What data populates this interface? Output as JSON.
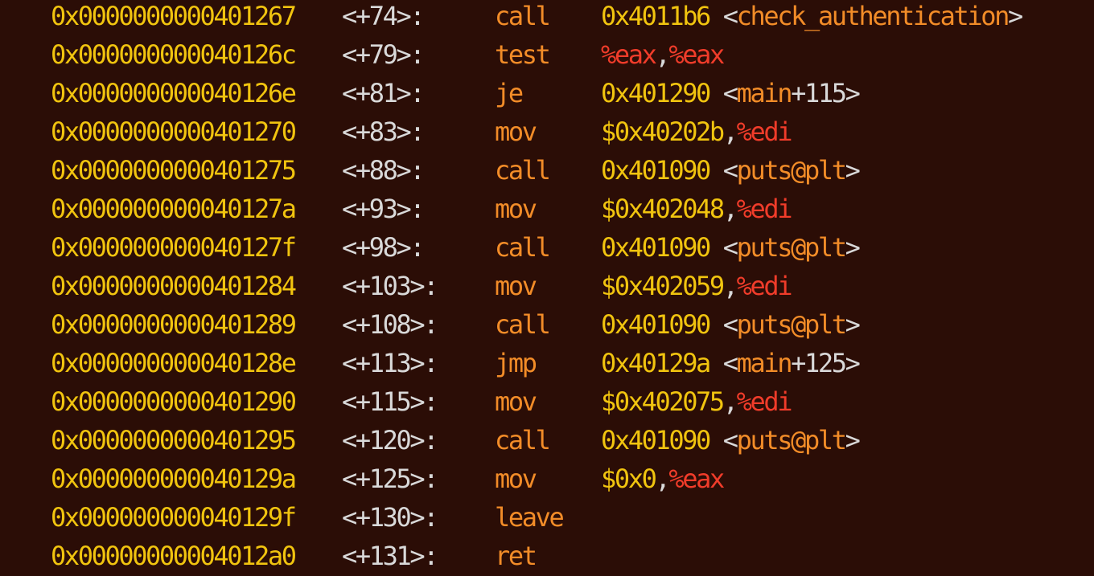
{
  "colors": {
    "background": "#2b0d06",
    "address": "#f1c40f",
    "offset": "#d9d9d9",
    "mnemonic": "#f28c28",
    "number": "#f1c40f",
    "register": "#f03c2a",
    "symbol": "#f28c28"
  },
  "disassembly": [
    {
      "address": "0x0000000000401267",
      "offset": "<+74>:",
      "mnemonic": "call",
      "operands": [
        {
          "t": "num",
          "v": "0x4011b6"
        },
        {
          "t": "plain",
          "v": " <"
        },
        {
          "t": "sym",
          "v": "check_authentication"
        },
        {
          "t": "plain",
          "v": ">"
        }
      ]
    },
    {
      "address": "0x000000000040126c",
      "offset": "<+79>:",
      "mnemonic": "test",
      "operands": [
        {
          "t": "reg",
          "v": "%eax"
        },
        {
          "t": "plain",
          "v": ","
        },
        {
          "t": "reg",
          "v": "%eax"
        }
      ]
    },
    {
      "address": "0x000000000040126e",
      "offset": "<+81>:",
      "mnemonic": "je",
      "operands": [
        {
          "t": "num",
          "v": "0x401290"
        },
        {
          "t": "plain",
          "v": " <"
        },
        {
          "t": "sym",
          "v": "main"
        },
        {
          "t": "plain",
          "v": "+115>"
        }
      ]
    },
    {
      "address": "0x0000000000401270",
      "offset": "<+83>:",
      "mnemonic": "mov",
      "operands": [
        {
          "t": "num",
          "v": "$0x40202b"
        },
        {
          "t": "plain",
          "v": ","
        },
        {
          "t": "reg",
          "v": "%edi"
        }
      ]
    },
    {
      "address": "0x0000000000401275",
      "offset": "<+88>:",
      "mnemonic": "call",
      "operands": [
        {
          "t": "num",
          "v": "0x401090"
        },
        {
          "t": "plain",
          "v": " <"
        },
        {
          "t": "sym",
          "v": "puts@plt"
        },
        {
          "t": "plain",
          "v": ">"
        }
      ]
    },
    {
      "address": "0x000000000040127a",
      "offset": "<+93>:",
      "mnemonic": "mov",
      "operands": [
        {
          "t": "num",
          "v": "$0x402048"
        },
        {
          "t": "plain",
          "v": ","
        },
        {
          "t": "reg",
          "v": "%edi"
        }
      ]
    },
    {
      "address": "0x000000000040127f",
      "offset": "<+98>:",
      "mnemonic": "call",
      "operands": [
        {
          "t": "num",
          "v": "0x401090"
        },
        {
          "t": "plain",
          "v": " <"
        },
        {
          "t": "sym",
          "v": "puts@plt"
        },
        {
          "t": "plain",
          "v": ">"
        }
      ]
    },
    {
      "address": "0x0000000000401284",
      "offset": "<+103>:",
      "mnemonic": "mov",
      "operands": [
        {
          "t": "num",
          "v": "$0x402059"
        },
        {
          "t": "plain",
          "v": ","
        },
        {
          "t": "reg",
          "v": "%edi"
        }
      ]
    },
    {
      "address": "0x0000000000401289",
      "offset": "<+108>:",
      "mnemonic": "call",
      "operands": [
        {
          "t": "num",
          "v": "0x401090"
        },
        {
          "t": "plain",
          "v": " <"
        },
        {
          "t": "sym",
          "v": "puts@plt"
        },
        {
          "t": "plain",
          "v": ">"
        }
      ]
    },
    {
      "address": "0x000000000040128e",
      "offset": "<+113>:",
      "mnemonic": "jmp",
      "operands": [
        {
          "t": "num",
          "v": "0x40129a"
        },
        {
          "t": "plain",
          "v": " <"
        },
        {
          "t": "sym",
          "v": "main"
        },
        {
          "t": "plain",
          "v": "+125>"
        }
      ]
    },
    {
      "address": "0x0000000000401290",
      "offset": "<+115>:",
      "mnemonic": "mov",
      "operands": [
        {
          "t": "num",
          "v": "$0x402075"
        },
        {
          "t": "plain",
          "v": ","
        },
        {
          "t": "reg",
          "v": "%edi"
        }
      ]
    },
    {
      "address": "0x0000000000401295",
      "offset": "<+120>:",
      "mnemonic": "call",
      "operands": [
        {
          "t": "num",
          "v": "0x401090"
        },
        {
          "t": "plain",
          "v": " <"
        },
        {
          "t": "sym",
          "v": "puts@plt"
        },
        {
          "t": "plain",
          "v": ">"
        }
      ]
    },
    {
      "address": "0x000000000040129a",
      "offset": "<+125>:",
      "mnemonic": "mov",
      "operands": [
        {
          "t": "num",
          "v": "$0x0"
        },
        {
          "t": "plain",
          "v": ","
        },
        {
          "t": "reg",
          "v": "%eax"
        }
      ]
    },
    {
      "address": "0x000000000040129f",
      "offset": "<+130>:",
      "mnemonic": "leave",
      "operands": []
    },
    {
      "address": "0x00000000004012a0",
      "offset": "<+131>:",
      "mnemonic": "ret",
      "operands": []
    }
  ]
}
